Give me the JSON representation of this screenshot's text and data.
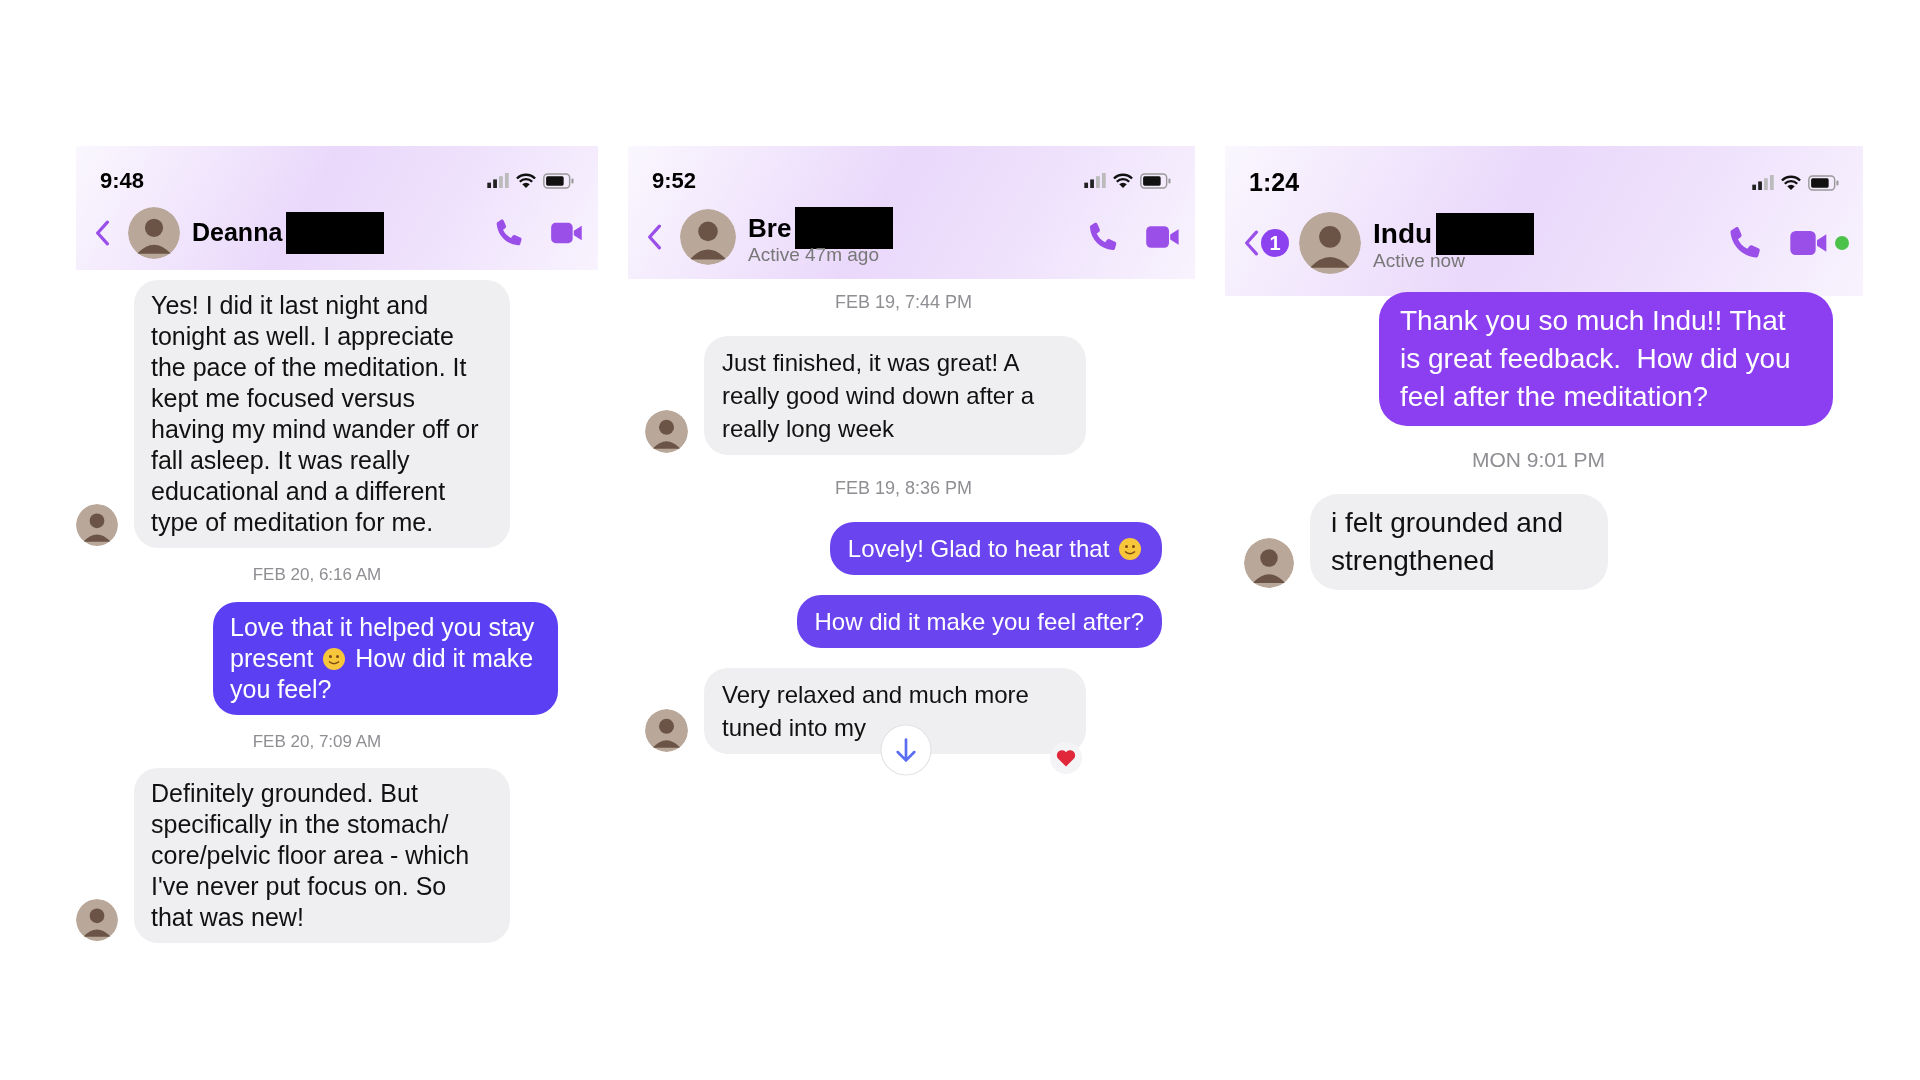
{
  "phones": [
    {
      "status_bar": {
        "time": "9:48"
      },
      "header": {
        "name": "Deanna",
        "redacted": true
      },
      "messages": [
        {
          "kind": "incoming",
          "text": "Yes! I did it last night and tonight as well. I appreciate the pace of the meditation. It kept me focused versus having my mind wander off or fall asleep. It was really educational and a different type of meditation for me."
        },
        {
          "kind": "timestamp",
          "text": "FEB 20, 6:16 AM"
        },
        {
          "kind": "outgoing",
          "parts": [
            {
              "kind": "text",
              "text": "Love that it helped you stay"
            },
            {
              "kind": "text",
              "text": "present"
            },
            {
              "kind": "emoji"
            },
            {
              "kind": "text",
              "text": "How did it make"
            },
            {
              "kind": "text",
              "text": "you feel?"
            }
          ]
        },
        {
          "kind": "timestamp",
          "text": "FEB 20, 7:09 AM"
        },
        {
          "kind": "incoming",
          "text": "Definitely grounded. But specifically in the stomach/ core/pelvic floor area - which I've never put focus on. So that was new!"
        }
      ]
    },
    {
      "status_bar": {
        "time": "9:52"
      },
      "header": {
        "name": "Bre",
        "redacted": true,
        "active_status": "Active 47m ago"
      },
      "messages": [
        {
          "kind": "timestamp",
          "text": "FEB 19, 7:44 PM"
        },
        {
          "kind": "incoming",
          "text": "Just finished, it was great! A really good wind down after a really long week"
        },
        {
          "kind": "timestamp",
          "text": "FEB 19, 8:36 PM"
        },
        {
          "kind": "outgoing",
          "parts": [
            {
              "kind": "text",
              "text": "Lovely! Glad to hear that"
            },
            {
              "kind": "emoji"
            }
          ]
        },
        {
          "kind": "outgoing",
          "text": "How did it make you feel after?"
        },
        {
          "kind": "incoming",
          "text": "Very relaxed and much more tuned into my",
          "reacted": true,
          "scroll_button": true
        }
      ]
    },
    {
      "status_bar": {
        "time": "1:24"
      },
      "header": {
        "name": "Indu",
        "redacted": true,
        "active_status": "Active now",
        "back_badge": "1",
        "online": true
      },
      "messages": [
        {
          "kind": "outgoing",
          "text": "Thank you so much Indu!! That is great feedback.  How did you feel after the meditation?"
        },
        {
          "kind": "timestamp",
          "text": "MON 9:01 PM"
        },
        {
          "kind": "incoming",
          "text": "i felt grounded and strengthened"
        }
      ]
    }
  ]
}
